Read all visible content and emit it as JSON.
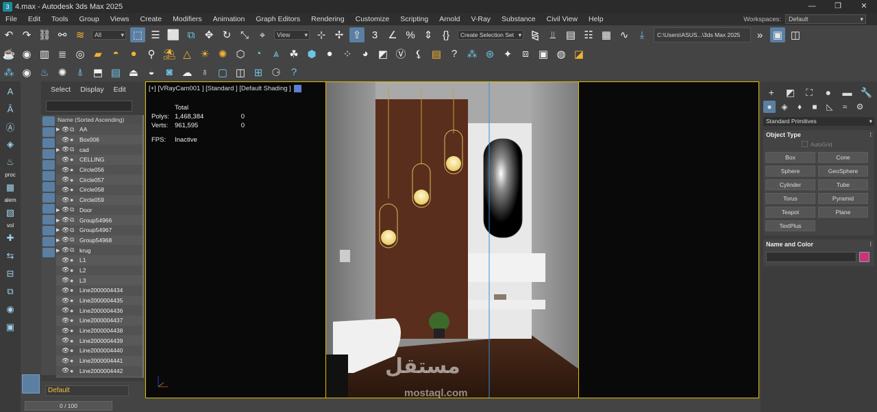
{
  "window": {
    "title": "4.max - Autodesk 3ds Max 2025",
    "app_icon": "3",
    "min": "—",
    "max": "❐",
    "close": "✕"
  },
  "menu": {
    "items": [
      "File",
      "Edit",
      "Tools",
      "Group",
      "Views",
      "Create",
      "Modifiers",
      "Animation",
      "Graph Editors",
      "Rendering",
      "Customize",
      "Scripting",
      "Arnold",
      "V-Ray",
      "Substance",
      "Civil View",
      "Help"
    ],
    "workspace_label": "Workspaces:",
    "workspace_value": "Default"
  },
  "main_toolbar": {
    "selection_filter": "All",
    "ref_coord": "View",
    "named_selection": "Create Selection Set",
    "project_path": "C:\\Users\\ASUS...\\3ds Max 2025"
  },
  "left_strip": {
    "labels": [
      "proc",
      "alem",
      "vol"
    ]
  },
  "scene_explorer": {
    "tabs": [
      "Select",
      "Display",
      "Edit"
    ],
    "column_header": "Name (Sorted Ascending)",
    "rows": [
      {
        "name": "AA",
        "expand": true
      },
      {
        "name": "Box006",
        "expand": false
      },
      {
        "name": "cad",
        "expand": true
      },
      {
        "name": "CELLING",
        "expand": false
      },
      {
        "name": "Circle056",
        "expand": false
      },
      {
        "name": "Circle057",
        "expand": false
      },
      {
        "name": "Circle058",
        "expand": false
      },
      {
        "name": "Circle059",
        "expand": false
      },
      {
        "name": "Door",
        "expand": true
      },
      {
        "name": "Group54966",
        "expand": true
      },
      {
        "name": "Group54967",
        "expand": true
      },
      {
        "name": "Group54968",
        "expand": true
      },
      {
        "name": "krug",
        "expand": true
      },
      {
        "name": "L1",
        "expand": false
      },
      {
        "name": "L2",
        "expand": false
      },
      {
        "name": "L3",
        "expand": false
      },
      {
        "name": "Line2000004434",
        "expand": false
      },
      {
        "name": "Line2000004435",
        "expand": false
      },
      {
        "name": "Line2000004436",
        "expand": false
      },
      {
        "name": "Line2000004437",
        "expand": false
      },
      {
        "name": "Line2000004438",
        "expand": false
      },
      {
        "name": "Line2000004439",
        "expand": false
      },
      {
        "name": "Line2000004440",
        "expand": false
      },
      {
        "name": "Line2000004441",
        "expand": false
      },
      {
        "name": "Line2000004442",
        "expand": false
      }
    ],
    "layer": "Default"
  },
  "time_slider": "0 / 100",
  "viewport": {
    "label": "[+] [VRayCam001 ] [Standard ] [Default Shading ]",
    "stats": {
      "header": "Total",
      "polys_label": "Polys:",
      "polys_value": "1,468,384",
      "polys_sel": "0",
      "verts_label": "Verts:",
      "verts_value": "961,595",
      "verts_sel": "0",
      "fps_label": "FPS:",
      "fps_value": "Inactive"
    }
  },
  "command_panel": {
    "category": "Standard Primitives",
    "object_type_title": "Object Type",
    "autogrid": "AutoGrid",
    "buttons": [
      "Box",
      "Cone",
      "Sphere",
      "GeoSphere",
      "Cylinder",
      "Tube",
      "Torus",
      "Pyramid",
      "Teapot",
      "Plane",
      "TextPlus"
    ],
    "name_color_title": "Name and Color",
    "color": "#c8347a",
    "rollout_minus": "−"
  },
  "watermark": {
    "arabic": "مستقل",
    "latin": "mostaql.com"
  }
}
